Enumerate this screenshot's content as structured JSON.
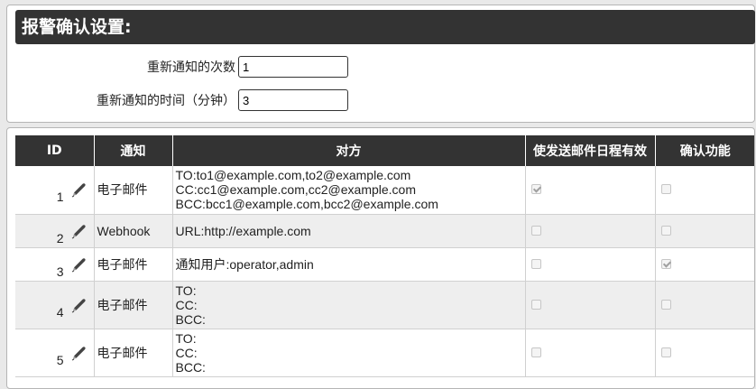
{
  "section": {
    "title": "报警确认设置:"
  },
  "form": {
    "retry_count_label": "重新通知的次数",
    "retry_count_value": "1",
    "retry_interval_label": "重新通知的时间（分钟）",
    "retry_interval_value": "3"
  },
  "table": {
    "headers": [
      "ID",
      "通知",
      "对方",
      "使发送邮件日程有效",
      "确认功能"
    ],
    "rows": [
      {
        "id": "1",
        "notify": "电子邮件",
        "target": [
          "TO:to1@example.com,to2@example.com",
          "CC:cc1@example.com,cc2@example.com",
          "BCC:bcc1@example.com,bcc2@example.com"
        ],
        "schedule_enabled": true,
        "confirm_enabled": false
      },
      {
        "id": "2",
        "notify": "Webhook",
        "target": [
          "URL:http://example.com"
        ],
        "schedule_enabled": false,
        "confirm_enabled": false
      },
      {
        "id": "3",
        "notify": "电子邮件",
        "target": [
          "通知用户:operator,admin"
        ],
        "schedule_enabled": false,
        "confirm_enabled": true
      },
      {
        "id": "4",
        "notify": "电子邮件",
        "target": [
          "TO:",
          "CC:",
          "BCC:"
        ],
        "schedule_enabled": false,
        "confirm_enabled": false
      },
      {
        "id": "5",
        "notify": "电子邮件",
        "target": [
          "TO:",
          "CC:",
          "BCC:"
        ],
        "schedule_enabled": false,
        "confirm_enabled": false
      }
    ]
  },
  "icons": {
    "edit": "pencil-icon"
  },
  "colors": {
    "header_bg": "#333333",
    "header_text": "#ffffff",
    "row_alt": "#eeeeee"
  }
}
